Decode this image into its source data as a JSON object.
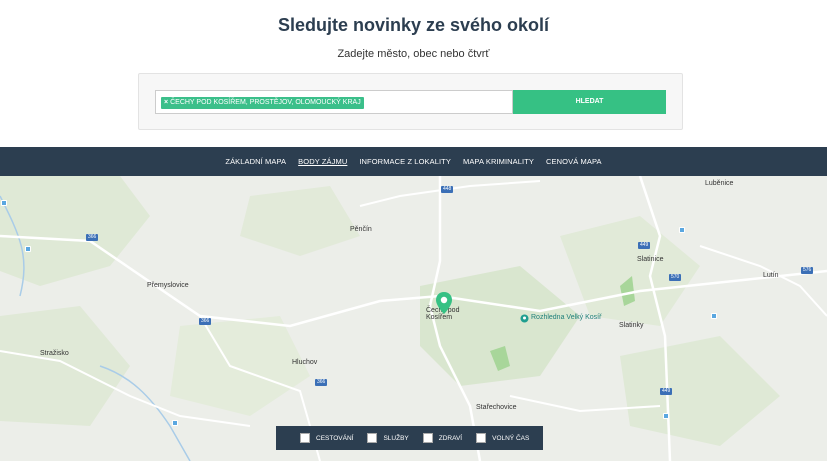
{
  "hero": {
    "title": "Sledujte novinky ze svého okolí",
    "subtitle": "Zadejte město, obec nebo čtvrť"
  },
  "search": {
    "tag_remove": "×",
    "tag_label": "ČECHY POD KOSÍŘEM, PROSTĚJOV, OLOMOUCKÝ KRAJ",
    "button_label": "HLEDAT"
  },
  "nav": {
    "items": [
      {
        "label": "ZÁKLADNÍ MAPA",
        "active": false
      },
      {
        "label": "BODY ZÁJMU",
        "active": true
      },
      {
        "label": "INFORMACE Z LOKALITY",
        "active": false
      },
      {
        "label": "MAPA KRIMINALITY",
        "active": false
      },
      {
        "label": "CENOVÁ MAPA",
        "active": false
      }
    ]
  },
  "map": {
    "places": {
      "lubenice": "Luběnice",
      "pencin": "Pěnčín",
      "slatinice": "Slatinice",
      "lutin": "Lutín",
      "premyslovice": "Přemyslovice",
      "cechy": "Čechy pod Kosířem",
      "slatinky": "Slatinky",
      "strazisko": "Stražisko",
      "hluchov": "Hluchov",
      "starechovice": "Stařechovice"
    },
    "poi": "Rozhledna Velký Kosíř",
    "roads": {
      "r448": "448",
      "r366a": "366",
      "r366b": "366",
      "r366c": "366",
      "r449a": "449",
      "r449b": "449",
      "r570": "570",
      "r576": "576"
    }
  },
  "filters": [
    {
      "label": "CESTOVÁNÍ"
    },
    {
      "label": "SLUŽBY"
    },
    {
      "label": "ZDRAVÍ"
    },
    {
      "label": "VOLNÝ ČAS"
    }
  ],
  "colors": {
    "accent": "#36c184",
    "nav_bg": "#2c3e50",
    "map_bg": "#eceee9"
  }
}
